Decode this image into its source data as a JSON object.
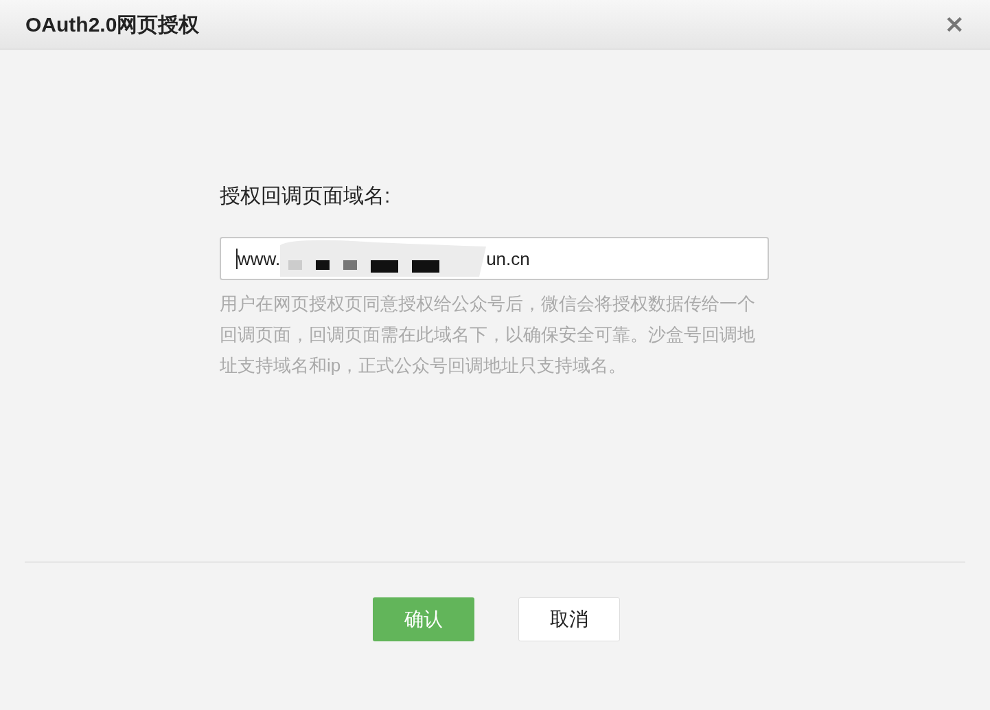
{
  "dialog": {
    "title": "OAuth2.0网页授权",
    "close": "✕"
  },
  "field": {
    "label": "授权回调页面域名:",
    "value_start": "www.",
    "value_end": "un.cn",
    "redacted": true
  },
  "help": "用户在网页授权页同意授权给公众号后，微信会将授权数据传给一个回调页面，回调页面需在此域名下，以确保安全可靠。沙盒号回调地址支持域名和ip，正式公众号回调地址只支持域名。",
  "buttons": [
    {
      "label": "确认",
      "kind": "primary"
    },
    {
      "label": "取消",
      "kind": "secondary"
    }
  ]
}
